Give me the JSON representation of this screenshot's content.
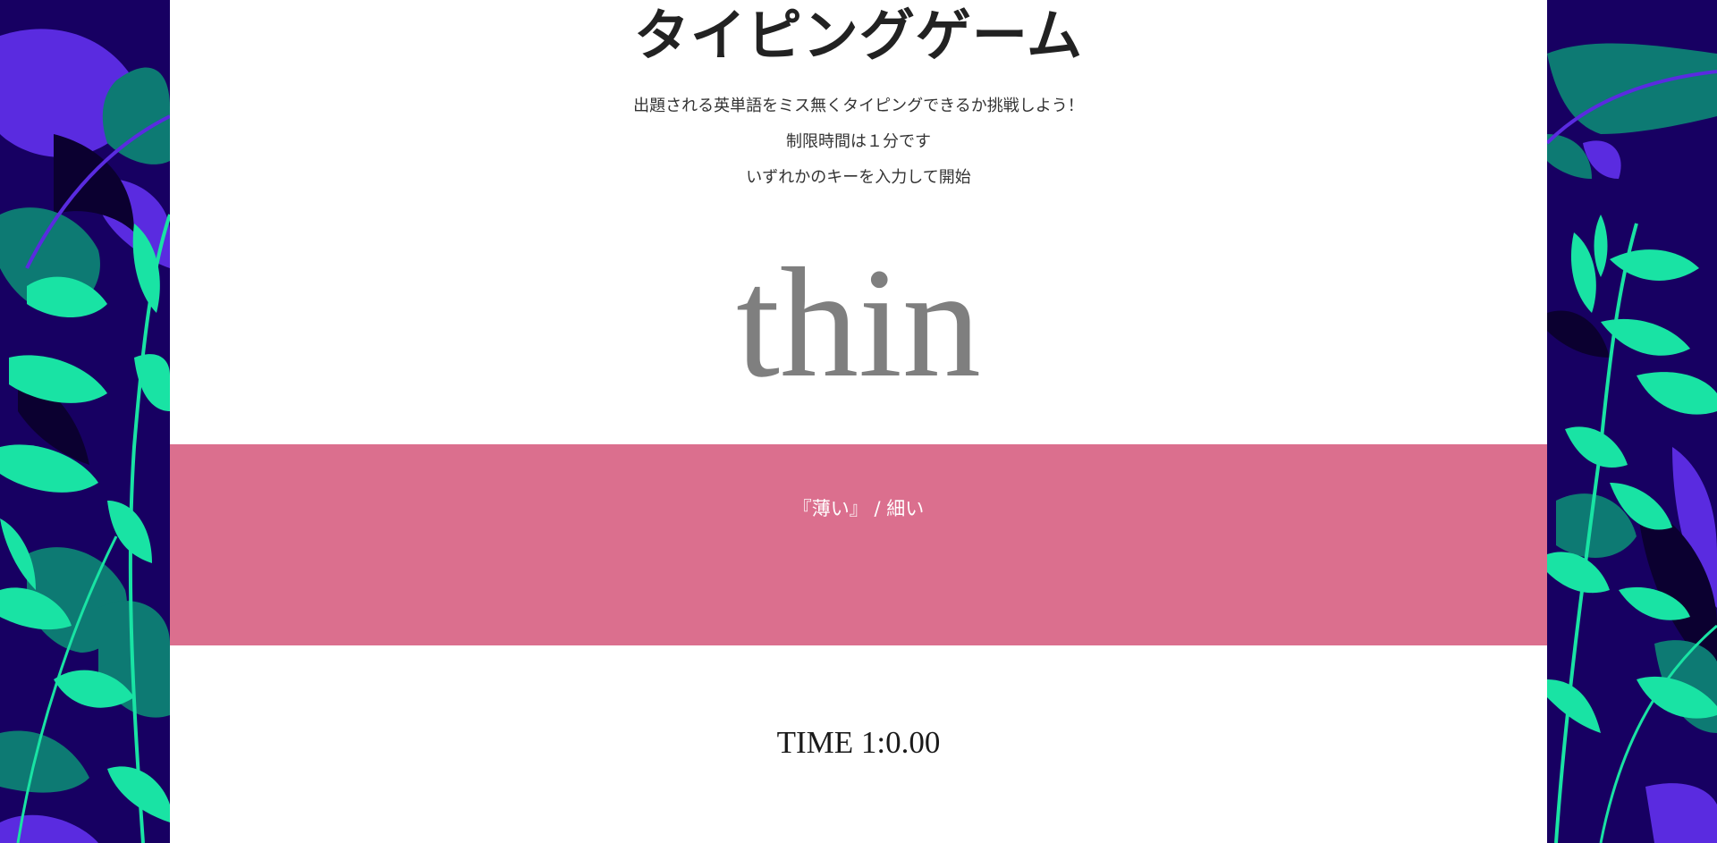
{
  "app": {
    "title": "タイピングゲーム",
    "instructions": [
      "出題される英単語をミス無くタイピングできるか挑戦しよう！",
      "制限時間は１分です",
      "いずれかのキーを入力して開始"
    ]
  },
  "game": {
    "current_word": "thin",
    "meaning": "『薄い』 / 細い",
    "timer": "TIME 1:0.00"
  },
  "theme": {
    "page_background": "#ffffff",
    "side_background": "#170062",
    "meaning_band": "#db6f8e",
    "word_color": "#7f7f7f",
    "leaf_mint": "#19e3a4",
    "leaf_teal": "#0d7a73",
    "leaf_violet": "#5a2be0"
  },
  "decorations": {
    "left_panel": "tropical-leaves-pattern",
    "right_panel": "tropical-leaves-pattern"
  }
}
